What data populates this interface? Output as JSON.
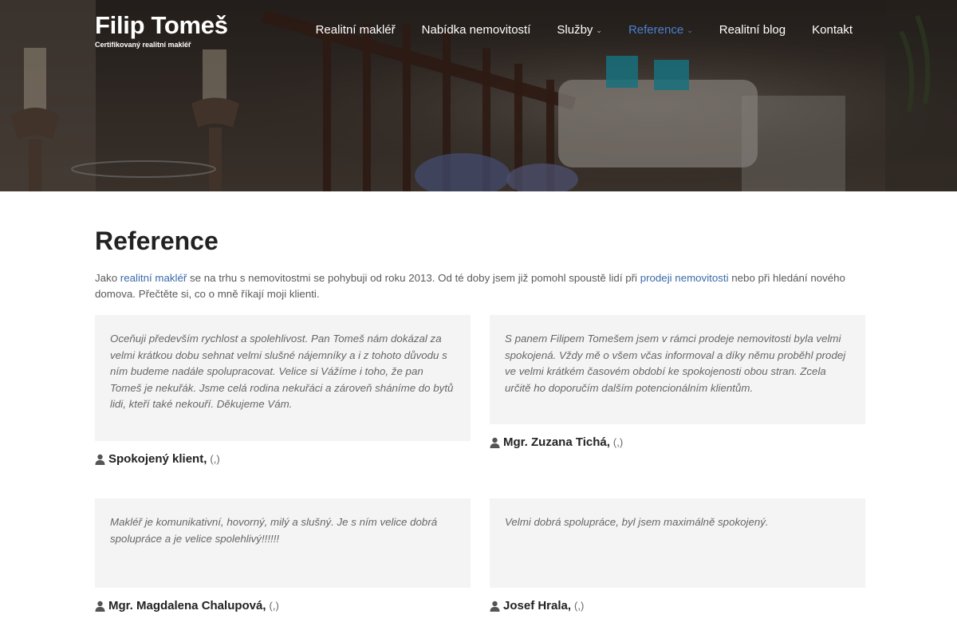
{
  "brand": {
    "title": "Filip Tomeš",
    "subtitle": "Certifikovaný realitní makléř"
  },
  "nav": {
    "items": [
      {
        "label": "Realitní makléř",
        "has_dropdown": false,
        "active": false
      },
      {
        "label": "Nabídka nemovitostí",
        "has_dropdown": false,
        "active": false
      },
      {
        "label": "Služby",
        "has_dropdown": true,
        "active": false
      },
      {
        "label": "Reference",
        "has_dropdown": true,
        "active": true
      },
      {
        "label": "Realitní blog",
        "has_dropdown": false,
        "active": false
      },
      {
        "label": "Kontakt",
        "has_dropdown": false,
        "active": false
      }
    ],
    "active_color": "#4a7fd0"
  },
  "page": {
    "title": "Reference",
    "intro": {
      "part1": "Jako ",
      "link1": "realitní makléř",
      "part2": " se na trhu s nemovitostmi se pohybuji od roku 2013. Od té doby jsem již pomohl spoustě lidí při ",
      "link2": "prodeji nemovitosti",
      "part3": " nebo při hledání nového domova. Přečtěte si, co o mně říkají moji klienti."
    },
    "link_color": "#3b6aa8"
  },
  "testimonials": [
    {
      "quote": "Oceňuji především rychlost a spolehlivost. Pan Tomeš nám dokázal za velmi krátkou dobu sehnat velmi slušné nájemníky a i z tohoto důvodu s ním budeme nadále spolupracovat. Velice si Vážíme i toho, že pan Tomeš je nekuřák. Jsme celá rodina nekuřáci a zároveň sháníme do bytů lidi, kteří také nekouří. Děkujeme Vám.",
      "name": "Spokojený klient,",
      "meta": "(,)"
    },
    {
      "quote": "S panem Filipem Tomešem jsem v rámci prodeje nemovitosti byla velmi spokojená. Vždy mě o všem včas informoval a díky němu proběhl prodej ve velmi krátkém časovém období ke spokojenosti obou stran. Zcela určitě ho doporučím dalším potencionálním klientům.",
      "name": "Mgr. Zuzana Tichá,",
      "meta": "(,)"
    },
    {
      "quote": "Makléř je komunikativní, hovorný, milý a slušný. Je s ním velice dobrá spolupráce a je velice spolehlivý!!!!!!",
      "name": "Mgr. Magdalena Chalupová,",
      "meta": "(,)"
    },
    {
      "quote": "Velmi dobrá spolupráce, byl jsem maximálně spokojený.",
      "name": "Josef Hrala,",
      "meta": "(,)"
    }
  ],
  "icons": {
    "author": "user-icon",
    "dropdown": "chevron-down-icon"
  }
}
